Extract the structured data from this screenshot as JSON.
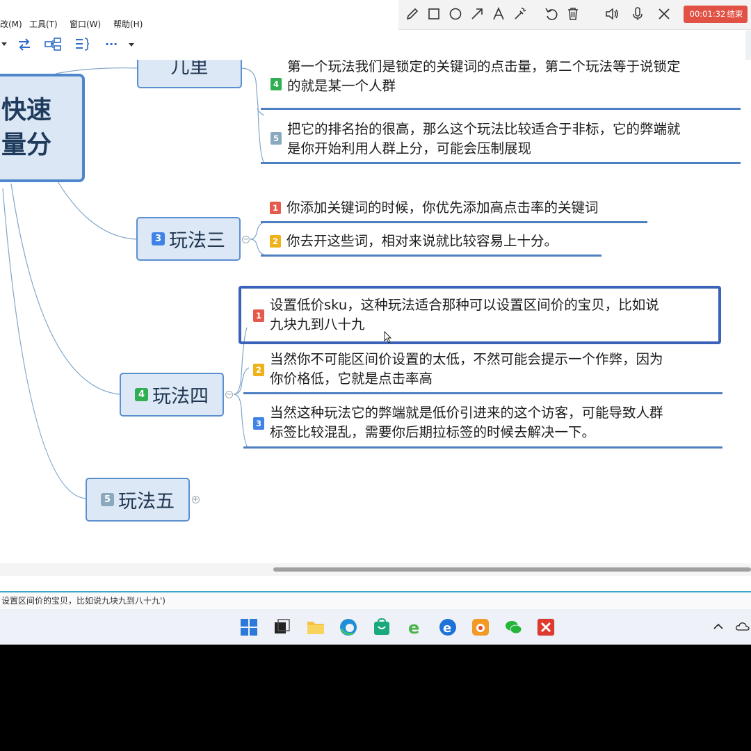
{
  "menu": {
    "items": [
      "改(M)",
      "工具(T)",
      "窗口(W)",
      "帮助(H)"
    ]
  },
  "toolbar": {
    "icons": [
      "dropdown-icon",
      "swap-icon",
      "structure-icon",
      "outline-icon",
      "more-icon",
      "dropdown-icon"
    ],
    "more_label": "···"
  },
  "overlay": {
    "icons": [
      "pencil-icon",
      "rectangle-icon",
      "circle-icon",
      "arrow-icon",
      "text-icon",
      "highlighter-icon",
      "undo-icon",
      "trash-icon",
      "speaker-icon",
      "microphone-icon",
      "close-icon"
    ],
    "timer": "00:01:32",
    "end_label": "结束",
    "accent": "#e25244"
  },
  "mindmap": {
    "central": {
      "line1": "快速",
      "line2": "量分"
    },
    "branch2": {
      "partial_label": "儿里",
      "leaves": [
        {
          "num": "4",
          "color": "#2fae52",
          "line1": "第一个玩法我们是锁定的关键词的点击量，第二个玩法等于说锁定",
          "line2": "的就是某一个人群"
        },
        {
          "num": "5",
          "color": "#8aa9bf",
          "line1": "把它的排名抬的很高，那么这个玩法比较适合于非标，它的弊端就",
          "line2": "是你开始利用人群上分，可能会压制展现"
        }
      ]
    },
    "branch3": {
      "num": "3",
      "label": "玩法三",
      "leaves": [
        {
          "num": "1",
          "line1": "你添加关键词的时候，你优先添加高点击率的关键词"
        },
        {
          "num": "2",
          "line1": "你去开这些词，相对来说就比较容易上十分。"
        }
      ]
    },
    "branch4": {
      "num": "4",
      "label": "玩法四",
      "leaves": [
        {
          "num": "1",
          "line1": "设置低价sku，这种玩法适合那种可以设置区间价的宝贝，比如说",
          "line2": "九块九到八十九"
        },
        {
          "num": "2",
          "line1": "当然你不可能区间价设置的太低，不然可能会提示一个作弊，因为",
          "line2": "你价格低，它就是点击率高"
        },
        {
          "num": "3",
          "line1": "当然这种玩法它的弊端就是低价引进来的这个访客，可能导致人群",
          "line2": "标签比较混乱，需要你后期拉标签的时候去解决一下。"
        }
      ]
    },
    "branch5": {
      "num": "5",
      "label": "玩法五"
    },
    "collapse_symbol": "−",
    "expand_symbol": "+"
  },
  "status": {
    "text": "设置区间价的宝贝，比如说九块九到八十九')"
  },
  "taskbar": {
    "icons": [
      "windows-start-icon",
      "task-view-icon",
      "file-explorer-icon",
      "edge-icon",
      "store-icon",
      "ie-icon",
      "edge-legacy-icon",
      "app-orange-icon",
      "wechat-icon",
      "xmind-icon"
    ],
    "tray": [
      "chevron-up-icon",
      "cloud-icon"
    ]
  }
}
